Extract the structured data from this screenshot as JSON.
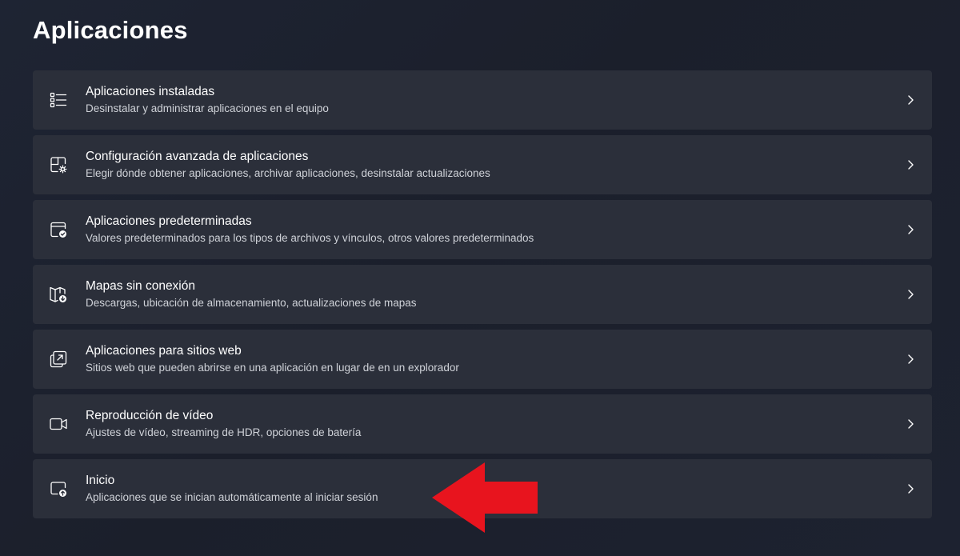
{
  "page": {
    "title": "Aplicaciones"
  },
  "items": [
    {
      "icon": "list-icon",
      "title": "Aplicaciones instaladas",
      "subtitle": "Desinstalar y administrar aplicaciones en el equipo"
    },
    {
      "icon": "app-settings-icon",
      "title": "Configuración avanzada de aplicaciones",
      "subtitle": "Elegir dónde obtener aplicaciones, archivar aplicaciones, desinstalar actualizaciones"
    },
    {
      "icon": "default-apps-icon",
      "title": "Aplicaciones predeterminadas",
      "subtitle": "Valores predeterminados para los tipos de archivos y vínculos, otros valores predeterminados"
    },
    {
      "icon": "offline-map-icon",
      "title": "Mapas sin conexión",
      "subtitle": "Descargas, ubicación de almacenamiento, actualizaciones de mapas"
    },
    {
      "icon": "open-in-app-icon",
      "title": "Aplicaciones para sitios web",
      "subtitle": "Sitios web que pueden abrirse en una aplicación en lugar de en un explorador"
    },
    {
      "icon": "video-camera-icon",
      "title": "Reproducción de vídeo",
      "subtitle": "Ajustes de vídeo, streaming de HDR, opciones de batería"
    },
    {
      "icon": "startup-icon",
      "title": "Inicio",
      "subtitle": "Aplicaciones que se inician automáticamente al iniciar sesión"
    }
  ],
  "colors": {
    "card_background": "#2b2f3a",
    "annotation_arrow": "#e8141e"
  }
}
